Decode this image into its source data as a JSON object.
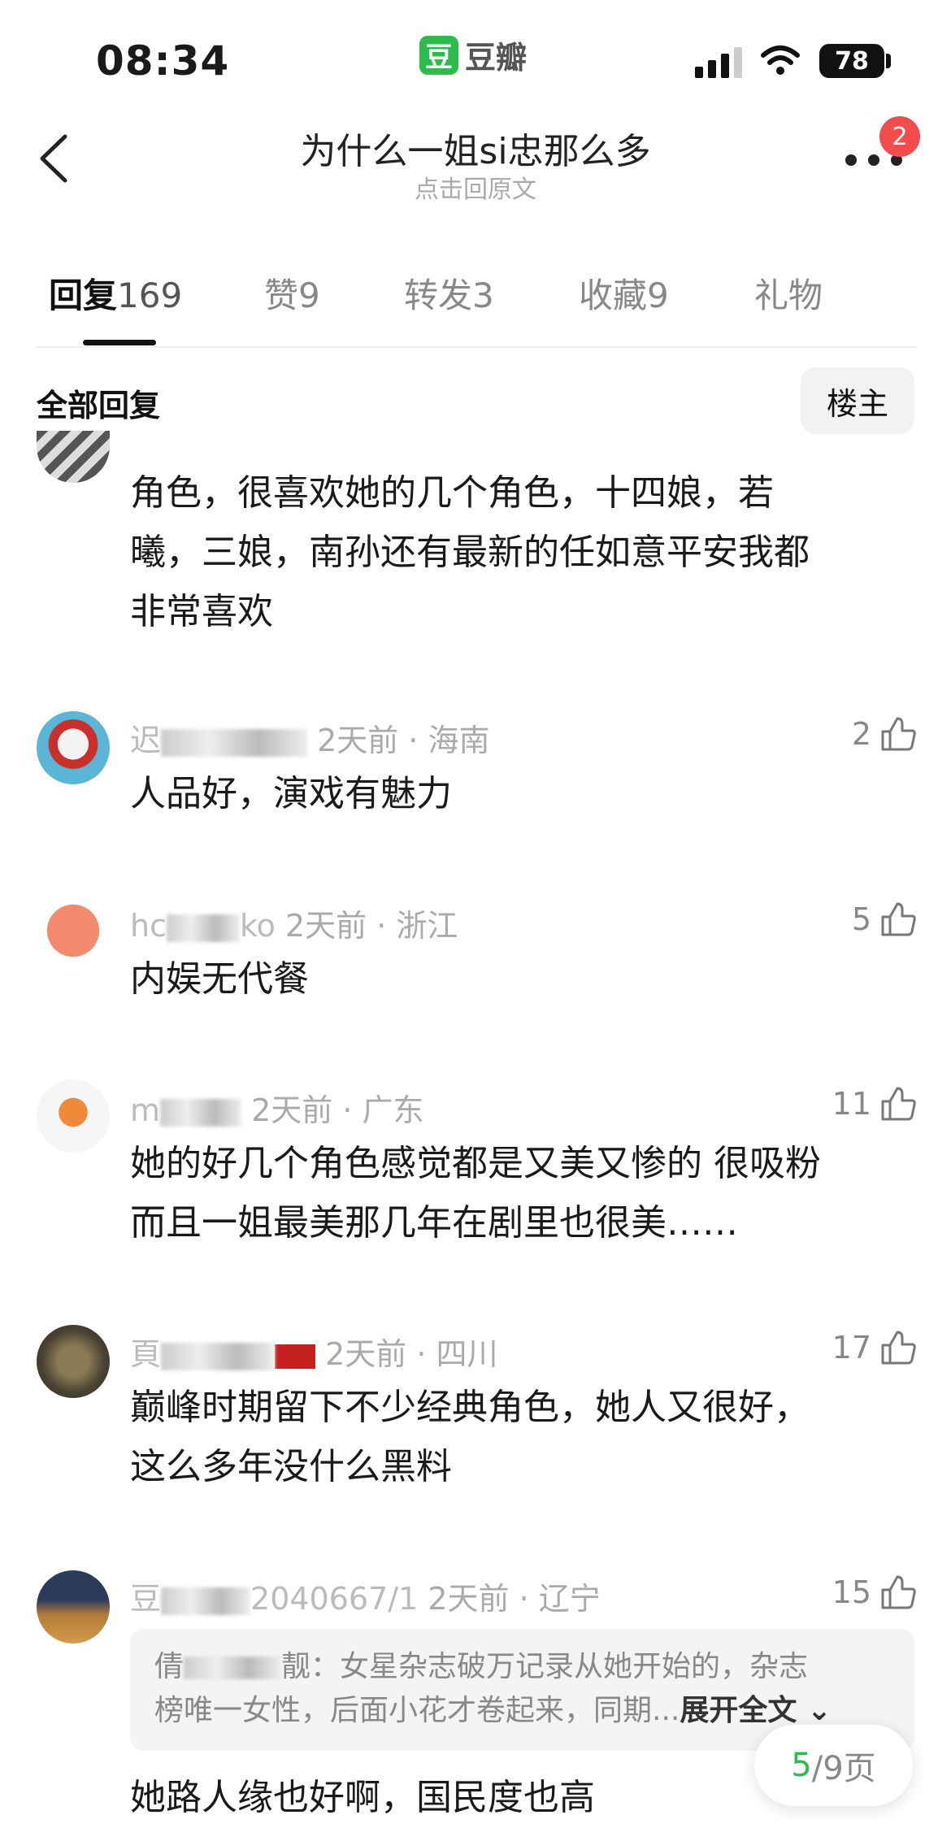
{
  "status_bar": {
    "time": "08:34",
    "app_logo": "豆",
    "app_name": "豆瓣",
    "battery": "78"
  },
  "header": {
    "title": "为什么一姐si忠那么多",
    "subtitle": "点击回原文",
    "notification_count": "2"
  },
  "tabs": [
    {
      "label": "回复",
      "count": "169",
      "active": true
    },
    {
      "label": "赞",
      "count": "9"
    },
    {
      "label": "转发",
      "count": "3"
    },
    {
      "label": "收藏",
      "count": "9"
    },
    {
      "label": "礼物",
      "count": ""
    }
  ],
  "section": {
    "label": "全部回复",
    "owner_button": "楼主"
  },
  "comments": [
    {
      "text_line1": "角色，很喜欢她的几个角色，十四娘，若",
      "text_line2": "曦，三娘，南孙还有最新的任如意平安我都",
      "text_line3": "非常喜欢"
    },
    {
      "name": "迟",
      "meta": "2天前 · 海南",
      "likes": "2",
      "text_line1": "人品好，演戏有魅力"
    },
    {
      "name": "hc",
      "name_tail": "ko",
      "meta": "2天前 · 浙江",
      "likes": "5",
      "text_line1": "内娱无代餐"
    },
    {
      "name": "m",
      "meta": "2天前 · 广东",
      "likes": "11",
      "text_line1": "她的好几个角色感觉都是又美又惨的 很吸粉",
      "text_line2": "而且一姐最美那几年在剧里也很美……"
    },
    {
      "name": "頁",
      "meta": "2天前 · 四川",
      "likes": "17",
      "text_line1": "巅峰时期留下不少经典角色，她人又很好，",
      "text_line2": "这么多年没什么黑料"
    },
    {
      "name": "豆",
      "name_tail": "2040667/1",
      "meta": "2天前 · 辽宁",
      "likes": "15",
      "text_line1": "她路人缘也好啊，国民度也高"
    }
  ],
  "quote": {
    "author": "倩",
    "author_tail": "靓：",
    "line1": "女星杂志破万记录从她开始的，杂志",
    "line2": "榜唯一女性，后面小花才卷起来，同期...",
    "expand": "展开全文"
  },
  "pager": {
    "current": "5",
    "total": "/9页"
  },
  "colors": {
    "accent": "#2dbb4e",
    "badge": "#f14d4d"
  }
}
